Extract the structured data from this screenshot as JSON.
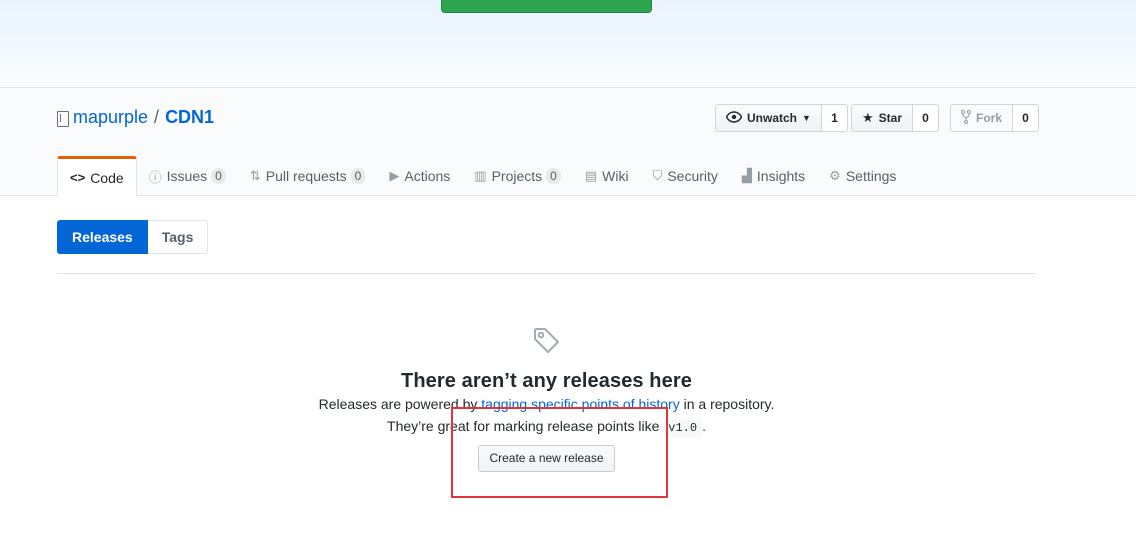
{
  "repo": {
    "owner": "mapurple",
    "separator": "/",
    "name": "CDN1"
  },
  "actions": {
    "watch": {
      "label": "Unwatch",
      "count": "1"
    },
    "star": {
      "label": "Star",
      "count": "0"
    },
    "fork": {
      "label": "Fork",
      "count": "0"
    }
  },
  "tabs": [
    {
      "label": "Code",
      "icon": "code-icon"
    },
    {
      "label": "Issues",
      "count": "0",
      "icon": "issue-icon"
    },
    {
      "label": "Pull requests",
      "count": "0",
      "icon": "pull-request-icon"
    },
    {
      "label": "Actions",
      "icon": "play-icon"
    },
    {
      "label": "Projects",
      "count": "0",
      "icon": "project-icon"
    },
    {
      "label": "Wiki",
      "icon": "book-icon"
    },
    {
      "label": "Security",
      "icon": "shield-icon"
    },
    {
      "label": "Insights",
      "icon": "graph-icon"
    },
    {
      "label": "Settings",
      "icon": "gear-icon"
    }
  ],
  "subnav": {
    "releases": "Releases",
    "tags": "Tags"
  },
  "blankslate": {
    "title": "There aren’t any releases here",
    "line1_pre": "Releases are powered by ",
    "line1_link": "tagging specific points of history",
    "line1_post": " in a repository.",
    "line2_pre": "They’re great for marking release points like ",
    "line2_code": "v1.0",
    "line2_post": ".",
    "button": "Create a new release"
  },
  "colors": {
    "accent": "#0366d6",
    "tab_underline": "#e36209",
    "highlight": "#e0353b",
    "banner_button": "#2ea44f"
  }
}
